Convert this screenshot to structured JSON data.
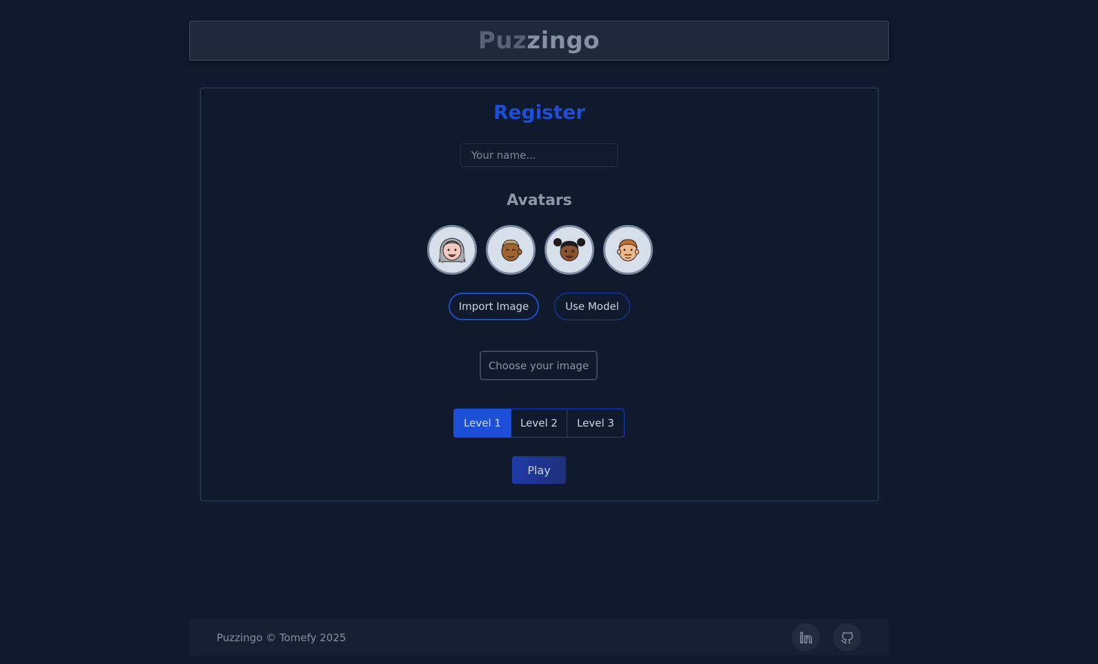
{
  "header": {
    "logo_part1": "Puz",
    "logo_part2": "zingo"
  },
  "register": {
    "title": "Register",
    "name_placeholder": "Your name...",
    "name_value": "",
    "avatars_title": "Avatars",
    "avatars": [
      {
        "icon": "gray-haired-woman-avatar-icon"
      },
      {
        "icon": "brown-boy-avatar-icon"
      },
      {
        "icon": "pigtails-girl-avatar-icon"
      },
      {
        "icon": "mustache-man-avatar-icon"
      }
    ],
    "import_image_label": "Import Image",
    "use_model_label": "Use Model",
    "choose_image_label": "Choose your image",
    "levels": [
      "Level 1",
      "Level 2",
      "Level 3"
    ],
    "selected_level": "Level 1",
    "play_label": "Play"
  },
  "footer": {
    "copyright": "Puzzingo © Tomefy 2025",
    "social": [
      {
        "icon": "linkedin-icon"
      },
      {
        "icon": "github-icon"
      }
    ]
  },
  "colors": {
    "background": "#0f1a2e",
    "accent": "#1d4ed8",
    "card_border": "#334155"
  }
}
